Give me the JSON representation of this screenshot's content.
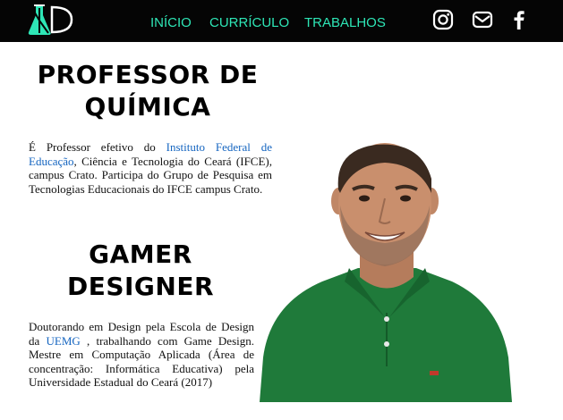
{
  "header": {
    "logo_text": "KD",
    "nav": [
      {
        "label": "INÍCIO"
      },
      {
        "label": "CURRÍCULO"
      },
      {
        "label": "TRABALHOS"
      }
    ],
    "social_icons": [
      "instagram-icon",
      "mail-icon",
      "facebook-icon"
    ],
    "colors": {
      "bar": "#050505",
      "accent": "#2ee6b6"
    }
  },
  "sections": [
    {
      "title": "PROFESSOR DE QUÍMICA",
      "text_before": "É Professor efetivo do ",
      "link": "Instituto Federal de Educação",
      "text_after": ", Ciência e Tecnologia do Ceará (IFCE), campus Crato. Participa do Grupo de Pesquisa em Tecnologias Educacionais do IFCE campus Crato."
    },
    {
      "title": "GAMER DESIGNER",
      "text_before": "Doutorando em Design pela Escola de Design da ",
      "link": "UEMG",
      "text_after": " , trabalhando com Game Design. Mestre em Computação Aplicada (Área de concentração: Informática Educativa) pela Universidade Estadual do Ceará (2017)"
    }
  ],
  "photo": {
    "shirt_color": "#1f7a3a",
    "skin_color": "#c98f6d",
    "hair_color": "#3a2a20"
  }
}
